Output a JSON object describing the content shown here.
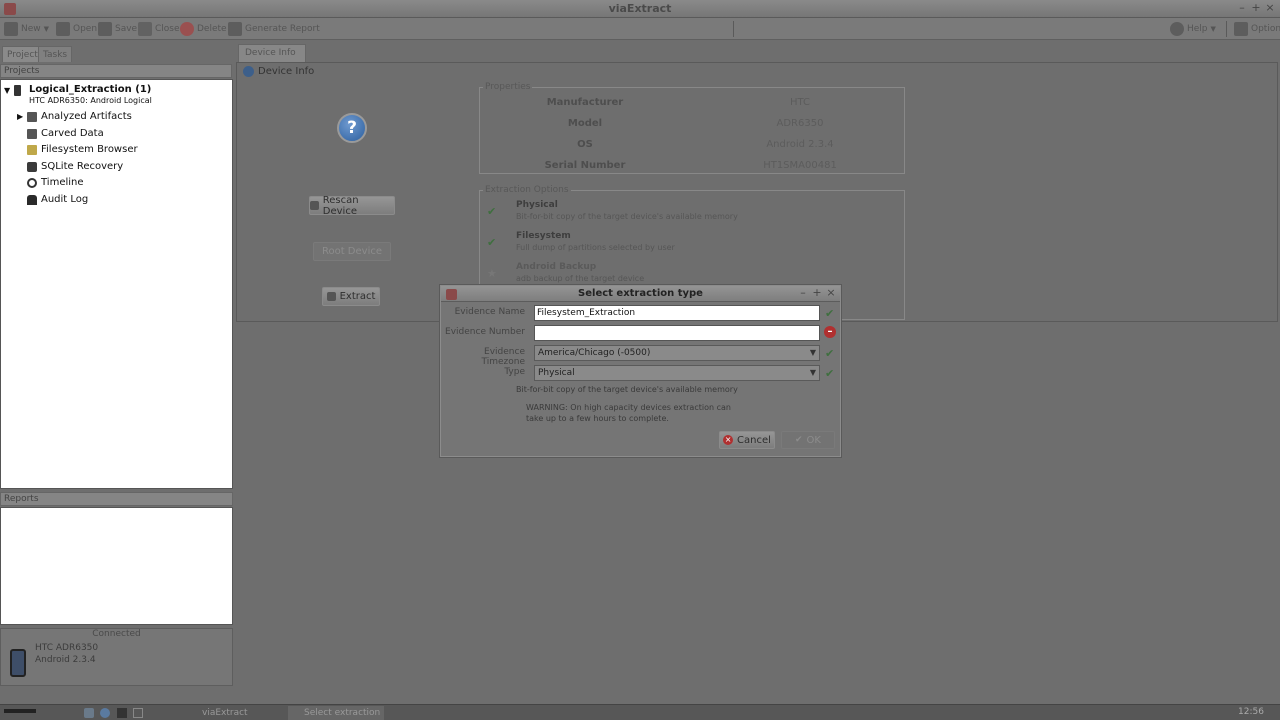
{
  "window": {
    "title": "viaExtract"
  },
  "toolbar": {
    "new_label": "New",
    "open_label": "Open",
    "save_label": "Save",
    "close_label": "Close",
    "delete_label": "Delete",
    "generate_report_label": "Generate Report",
    "help_label": "Help",
    "options_label": "Options"
  },
  "left_tabs": {
    "projects": "Projects",
    "tasks": "Tasks"
  },
  "project_panel": {
    "header": "Projects",
    "root_title": "Logical_Extraction (1)",
    "root_subtitle": "HTC ADR6350: Android Logical",
    "items": [
      {
        "label": "Analyzed Artifacts"
      },
      {
        "label": "Carved Data"
      },
      {
        "label": "Filesystem Browser"
      },
      {
        "label": "SQLite Recovery"
      },
      {
        "label": "Timeline"
      },
      {
        "label": "Audit Log"
      }
    ]
  },
  "reports_panel": {
    "header": "Reports"
  },
  "connected_panel": {
    "header": "Connected",
    "device_name": "HTC ADR6350",
    "device_os": "Android 2.3.4"
  },
  "device_info": {
    "tab_label": "Device Info",
    "pane_title": "Device Info",
    "rescan_label": "Rescan Device",
    "root_label": "Root Device",
    "extract_label": "Extract"
  },
  "properties": {
    "title": "Properties",
    "rows": [
      {
        "label": "Manufacturer",
        "value": "HTC"
      },
      {
        "label": "Model",
        "value": "ADR6350"
      },
      {
        "label": "OS",
        "value": "Android 2.3.4"
      },
      {
        "label": "Serial Number",
        "value": "HT1SMA00481"
      }
    ]
  },
  "extraction_options": {
    "title": "Extraction Options",
    "options": [
      {
        "title": "Physical",
        "desc": "Bit-for-bit copy of the target device's available memory"
      },
      {
        "title": "Filesystem",
        "desc": "Full dump of partitions selected by user"
      },
      {
        "title": "Android Backup",
        "desc": "adb backup of the target device"
      }
    ]
  },
  "dialog": {
    "title": "Select extraction type",
    "evidence_name_label": "Evidence Name",
    "evidence_name_value": "Filesystem_Extraction",
    "evidence_number_label": "Evidence Number",
    "evidence_number_value": "",
    "timezone_label": "Evidence Timezone",
    "timezone_value": "America/Chicago (-0500)",
    "type_label": "Type",
    "type_value": "Physical",
    "type_desc": "Bit-for-bit copy of the target device's available memory",
    "warning_line1": "WARNING: On high capacity devices extraction can",
    "warning_line2": "take up to a few hours to complete.",
    "cancel_label": "Cancel",
    "ok_label": "OK"
  },
  "taskbar": {
    "item1": "viaExtract",
    "item2": "Select extraction t",
    "clock": "12:56"
  },
  "colors": {
    "error_icon": "#b03030",
    "check_green": "#3f6f3f",
    "info_blue": "#2c5f9e"
  }
}
